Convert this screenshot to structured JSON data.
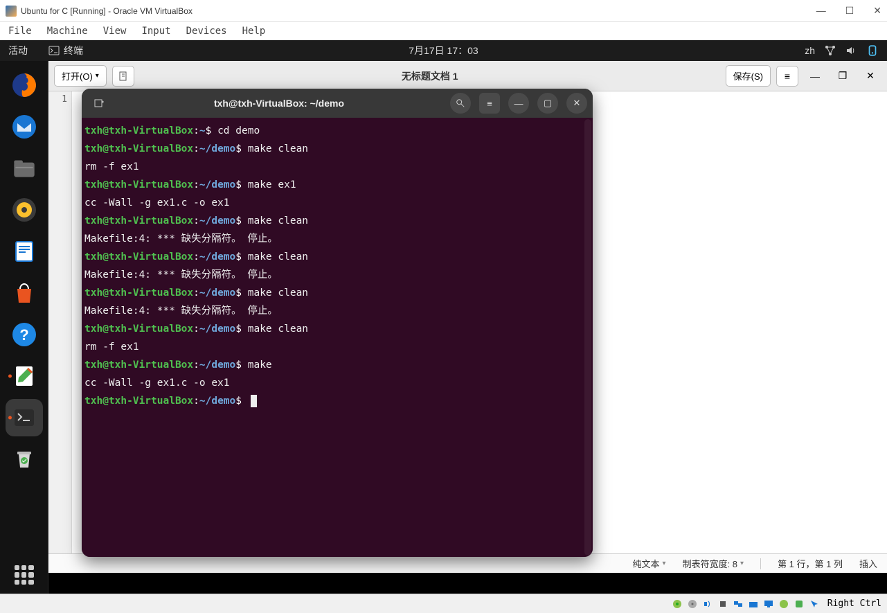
{
  "vbox": {
    "title": "Ubuntu for C [Running] - Oracle VM VirtualBox",
    "menu": [
      "File",
      "Machine",
      "View",
      "Input",
      "Devices",
      "Help"
    ],
    "hostkey": "Right Ctrl"
  },
  "ubuntu_topbar": {
    "activities": "活动",
    "app_label": "终端",
    "clock": "7月17日  17：03",
    "lang": "zh"
  },
  "dock": {
    "items": [
      "firefox",
      "thunderbird",
      "files",
      "rhythmbox",
      "libreoffice",
      "software",
      "help",
      "texteditor",
      "terminal",
      "trash"
    ],
    "active": "terminal",
    "running": [
      "texteditor",
      "terminal"
    ]
  },
  "gedit": {
    "open_label": "打开(O)",
    "title": "无标题文档 1",
    "save_label": "保存(S)",
    "line_number": "1",
    "status": {
      "mode": "纯文本",
      "tab": "制表符宽度: 8",
      "pos": "第 1 行，第 1 列",
      "ins": "插入"
    }
  },
  "terminal": {
    "title": "txh@txh-VirtualBox: ~/demo",
    "prompt": {
      "userhost": "txh@txh-VirtualBox",
      "home": "~",
      "path": "~/demo"
    },
    "lines": [
      {
        "t": "prompt_home",
        "cmd": " cd demo"
      },
      {
        "t": "prompt",
        "cmd": " make clean"
      },
      {
        "t": "out",
        "text": "rm -f ex1"
      },
      {
        "t": "prompt",
        "cmd": " make ex1"
      },
      {
        "t": "out",
        "text": "cc -Wall -g    ex1.c   -o ex1"
      },
      {
        "t": "prompt",
        "cmd": " make clean"
      },
      {
        "t": "out",
        "text": "Makefile:4: *** 缺失分隔符。 停止。"
      },
      {
        "t": "prompt",
        "cmd": " make clean"
      },
      {
        "t": "out",
        "text": "Makefile:4: *** 缺失分隔符。 停止。"
      },
      {
        "t": "prompt",
        "cmd": " make clean"
      },
      {
        "t": "out",
        "text": "Makefile:4: *** 缺失分隔符。 停止。"
      },
      {
        "t": "prompt",
        "cmd": " make clean"
      },
      {
        "t": "out",
        "text": "rm -f ex1"
      },
      {
        "t": "prompt",
        "cmd": " make"
      },
      {
        "t": "out",
        "text": "cc -Wall -g    ex1.c   -o ex1"
      },
      {
        "t": "prompt",
        "cmd": " ",
        "cursor": true
      }
    ]
  }
}
